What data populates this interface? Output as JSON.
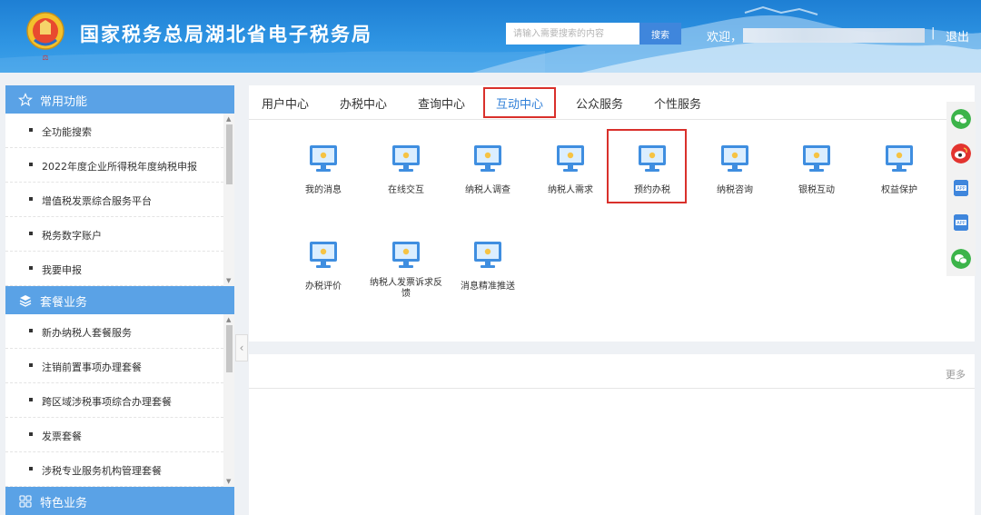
{
  "header": {
    "title": "国家税务总局湖北省电子税务局",
    "search_placeholder": "请输入需要搜索的内容",
    "search_button": "搜索",
    "welcome": "欢迎，",
    "separator": "|",
    "logout": "退出"
  },
  "sidebar": {
    "sections": [
      {
        "label": "常用功能",
        "icon": "star-icon",
        "items": [
          "全功能搜索",
          "2022年度企业所得税年度纳税申报",
          "增值税发票综合服务平台",
          "税务数字账户",
          "我要申报"
        ]
      },
      {
        "label": "套餐业务",
        "icon": "layers-icon",
        "items": [
          "新办纳税人套餐服务",
          "注销前置事项办理套餐",
          "跨区域涉税事项综合办理套餐",
          "发票套餐",
          "涉税专业服务机构管理套餐"
        ]
      },
      {
        "label": "特色业务",
        "icon": "grid-icon",
        "items": []
      }
    ]
  },
  "main": {
    "tabs": [
      "用户中心",
      "办税中心",
      "查询中心",
      "互动中心",
      "公众服务",
      "个性服务"
    ],
    "active_tab": "互动中心",
    "tiles": [
      "我的消息",
      "在线交互",
      "纳税人调查",
      "纳税人需求",
      "预约办税",
      "纳税咨询",
      "银税互动",
      "权益保护",
      "办税评价",
      "纳税人发票诉求反馈",
      "消息精准推送"
    ],
    "highlighted_tile": "预约办税",
    "more": "更多"
  },
  "float_bar": {
    "icons": [
      "wechat-icon",
      "weibo-icon",
      "app-icon",
      "app-icon",
      "wechat-icon"
    ],
    "app_label": "APP"
  },
  "colors": {
    "header": "#2f95e3",
    "section_header": "#5aa2e6",
    "highlight": "#d9302b",
    "active_tab": "#2f7fd8"
  }
}
